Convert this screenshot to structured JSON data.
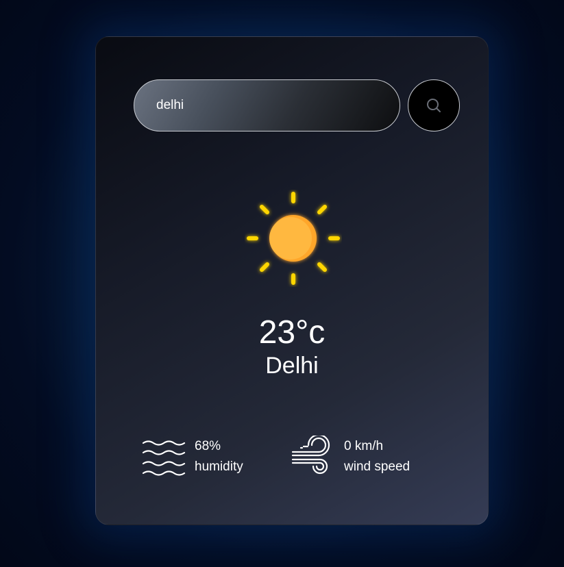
{
  "search": {
    "value": "delhi",
    "button_icon": "search-icon"
  },
  "weather": {
    "icon": "sun-icon",
    "temperature": "23°c",
    "city": "Delhi"
  },
  "details": {
    "humidity": {
      "value": "68%",
      "label": "humidity",
      "icon": "humidity-waves-icon"
    },
    "wind": {
      "value": "0 km/h",
      "label": "wind speed",
      "icon": "wind-icon"
    }
  },
  "colors": {
    "sun_core": "#FFB23F",
    "sun_rays": "#FFD600",
    "text": "#FFFFFF"
  }
}
